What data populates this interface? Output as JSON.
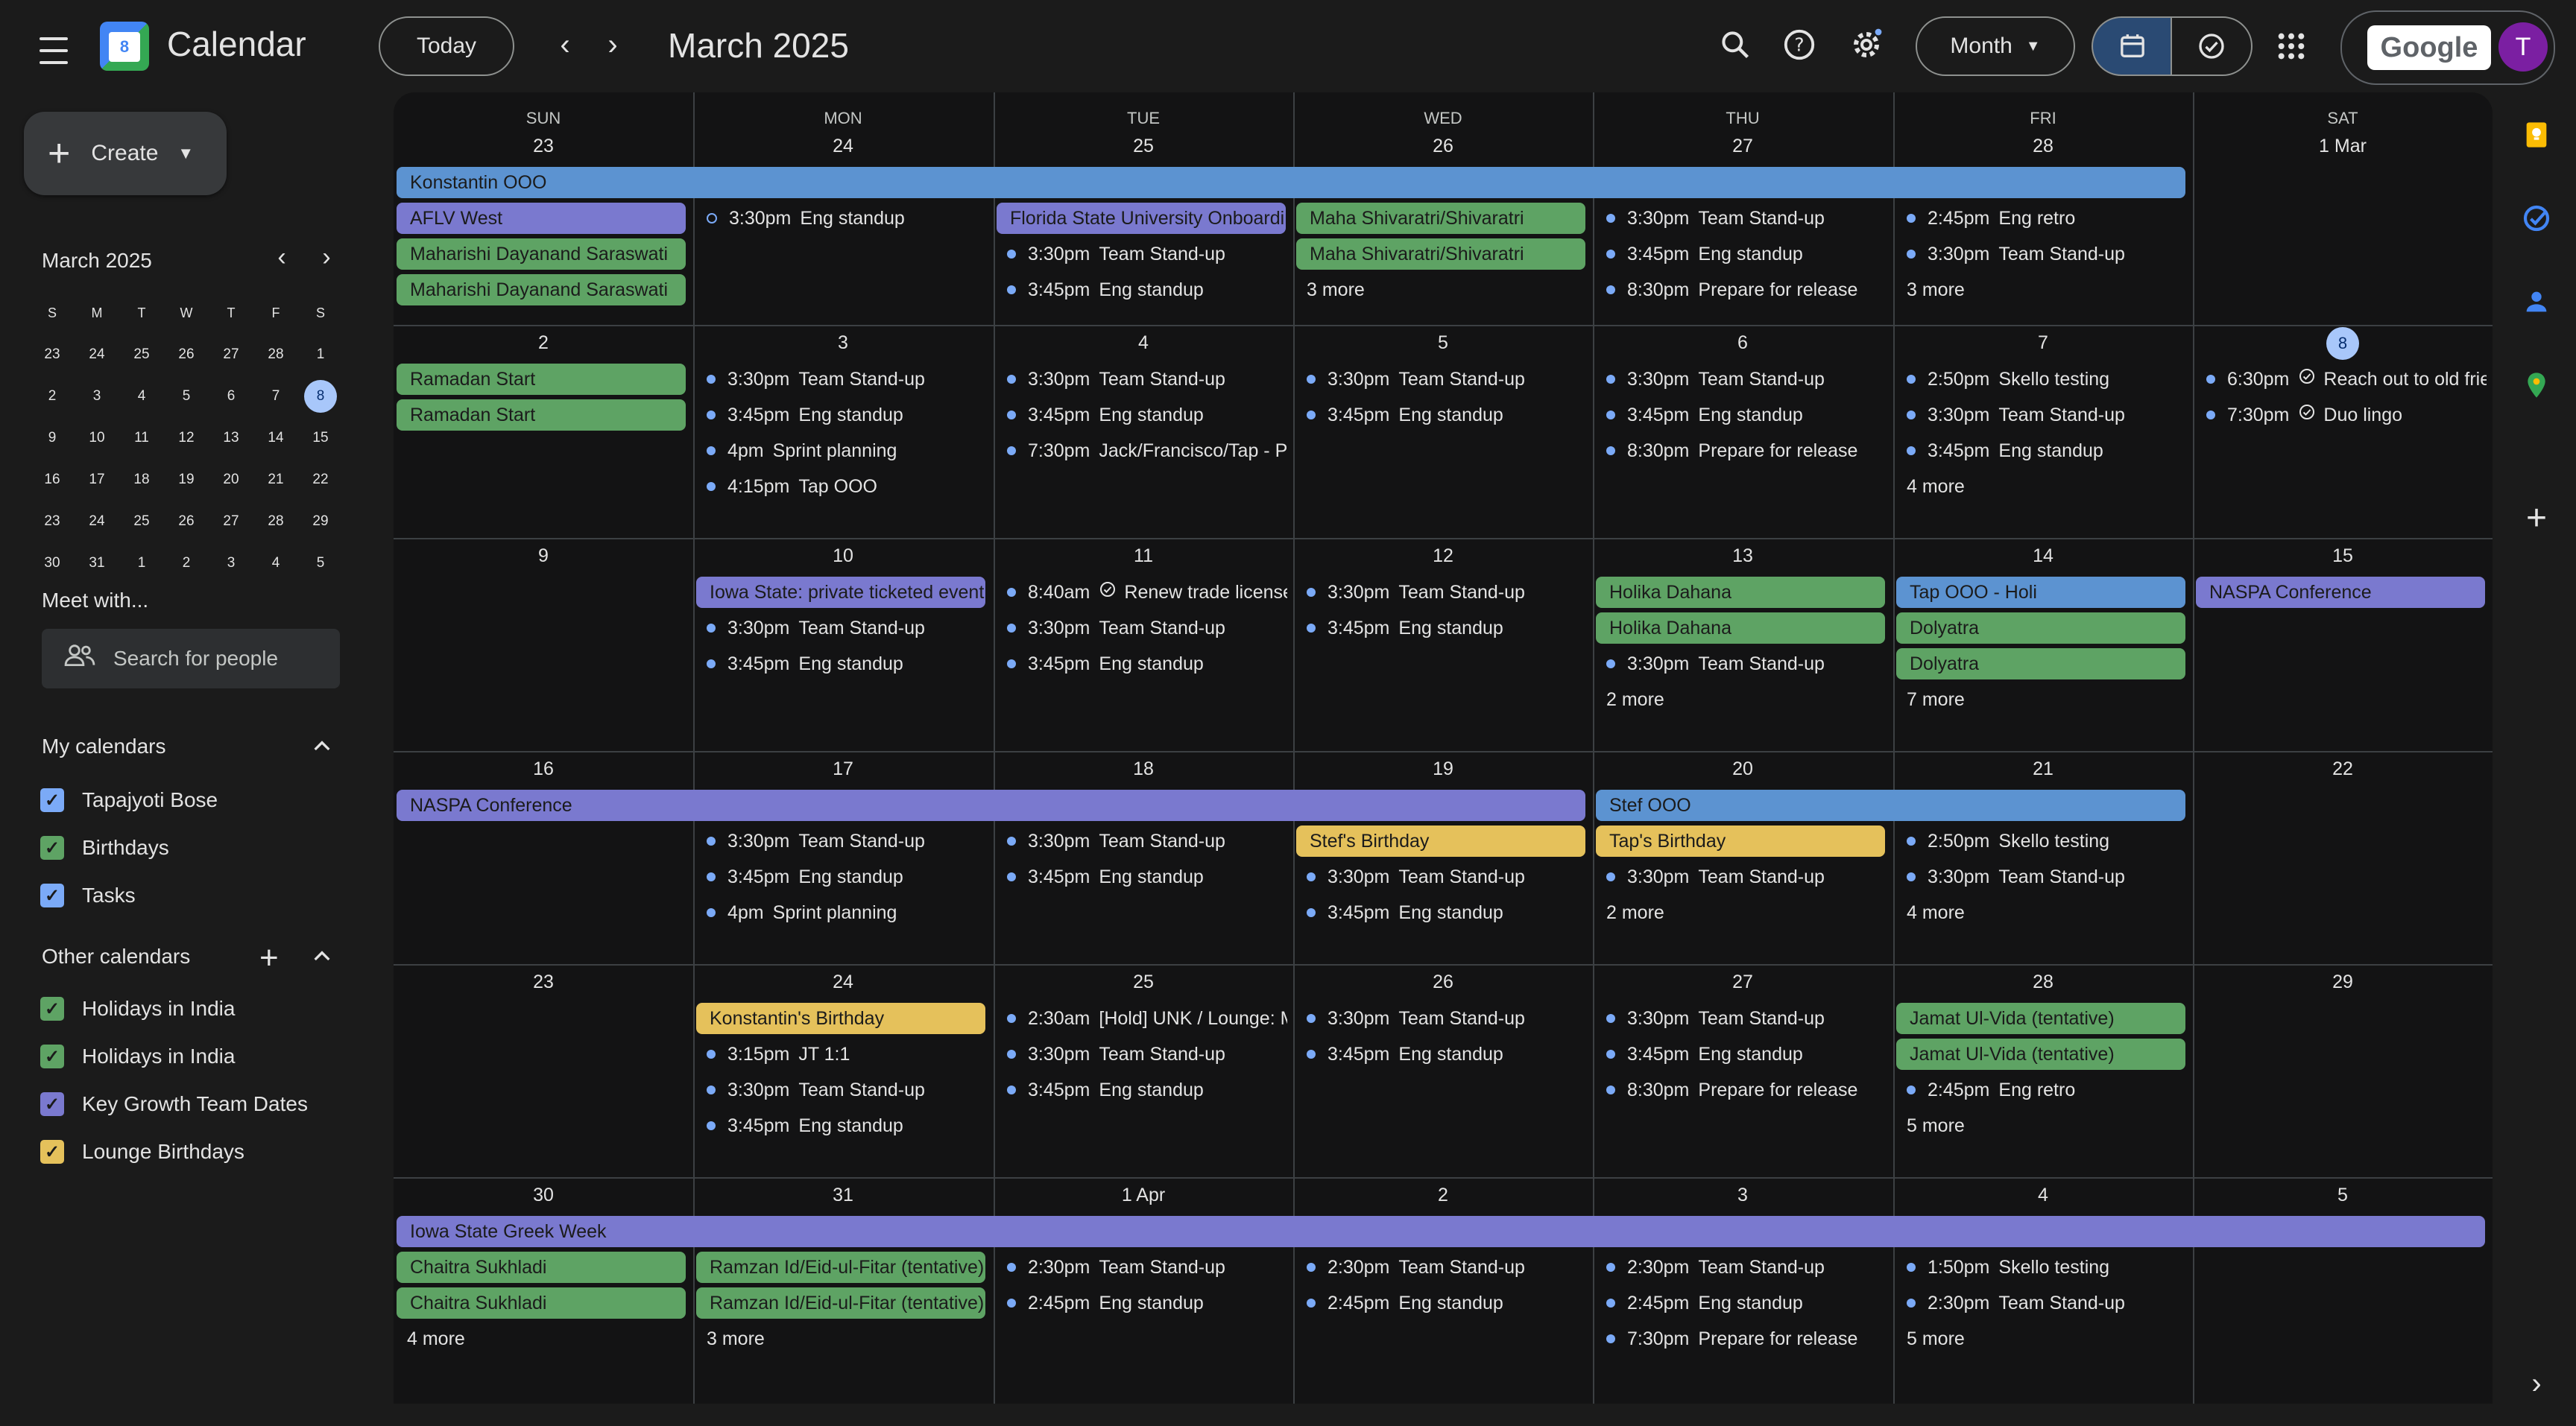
{
  "header": {
    "app_title": "Calendar",
    "logo_day": "8",
    "today_label": "Today",
    "prev_label": "‹",
    "next_label": "›",
    "month_title": "March 2025",
    "view_label": "Month",
    "google_label": "Google",
    "avatar_letter": "T"
  },
  "sidebar": {
    "create_label": "Create",
    "mini_title": "March 2025",
    "mini_prev": "‹",
    "mini_next": "›",
    "mini_weekdays": [
      "S",
      "M",
      "T",
      "W",
      "T",
      "F",
      "S"
    ],
    "mini_weeks": [
      [
        "23",
        "24",
        "25",
        "26",
        "27",
        "28",
        "1"
      ],
      [
        "2",
        "3",
        "4",
        "5",
        "6",
        "7",
        "8"
      ],
      [
        "9",
        "10",
        "11",
        "12",
        "13",
        "14",
        "15"
      ],
      [
        "16",
        "17",
        "18",
        "19",
        "20",
        "21",
        "22"
      ],
      [
        "23",
        "24",
        "25",
        "26",
        "27",
        "28",
        "29"
      ],
      [
        "30",
        "31",
        "1",
        "2",
        "3",
        "4",
        "5"
      ]
    ],
    "mini_today": "8",
    "meet_label": "Meet with...",
    "people_placeholder": "Search for people",
    "my_calendars_label": "My calendars",
    "my_calendars": [
      {
        "name": "Tapajyoti Bose",
        "color": "#7baaf7"
      },
      {
        "name": "Birthdays",
        "color": "#5ea364"
      },
      {
        "name": "Tasks",
        "color": "#7baaf7"
      }
    ],
    "other_calendars_label": "Other calendars",
    "other_calendars": [
      {
        "name": "Holidays in India",
        "color": "#5ea364"
      },
      {
        "name": "Holidays in India",
        "color": "#5ea364"
      },
      {
        "name": "Key Growth Team Dates",
        "color": "#7a79cf"
      },
      {
        "name": "Lounge Birthdays",
        "color": "#e5c15b"
      }
    ]
  },
  "grid": {
    "weekdays": [
      "SUN",
      "MON",
      "TUE",
      "WED",
      "THU",
      "FRI",
      "SAT"
    ],
    "weeks": [
      {
        "days": [
          "23",
          "24",
          "25",
          "26",
          "27",
          "28",
          "1 Mar"
        ],
        "bars": [
          {
            "text": "Konstantin OOO",
            "start": 0,
            "span": 6,
            "row": 0,
            "color": "blue"
          },
          {
            "text": "AFLV West",
            "start": 0,
            "span": 1,
            "row": 1,
            "color": "purple"
          },
          {
            "text": "Maharishi Dayanand Saraswati",
            "start": 0,
            "span": 1,
            "row": 2,
            "color": "green"
          },
          {
            "text": "Maharishi Dayanand Saraswati",
            "start": 0,
            "span": 1,
            "row": 3,
            "color": "green"
          },
          {
            "text": "Florida State University Onboarding",
            "start": 2,
            "span": 1,
            "row": 1,
            "color": "purple"
          },
          {
            "text": "Maha Shivaratri/Shivaratri",
            "start": 3,
            "span": 1,
            "row": 1,
            "color": "green"
          },
          {
            "text": "Maha Shivaratri/Shivaratri",
            "start": 3,
            "span": 1,
            "row": 2,
            "color": "green"
          }
        ],
        "events": [
          {
            "day": 1,
            "row": 1,
            "time": "3:30pm",
            "title": "Eng standup",
            "hollow": true
          },
          {
            "day": 2,
            "row": 2,
            "time": "3:30pm",
            "title": "Team Stand-up"
          },
          {
            "day": 2,
            "row": 3,
            "time": "3:45pm",
            "title": "Eng standup"
          },
          {
            "day": 4,
            "row": 1,
            "time": "3:30pm",
            "title": "Team Stand-up"
          },
          {
            "day": 4,
            "row": 2,
            "time": "3:45pm",
            "title": "Eng standup"
          },
          {
            "day": 4,
            "row": 3,
            "time": "8:30pm",
            "title": "Prepare for release"
          },
          {
            "day": 5,
            "row": 1,
            "time": "2:45pm",
            "title": "Eng retro"
          },
          {
            "day": 5,
            "row": 2,
            "time": "3:30pm",
            "title": "Team Stand-up"
          }
        ],
        "more": [
          {
            "day": 3,
            "row": 3,
            "text": "3 more"
          },
          {
            "day": 5,
            "row": 3,
            "text": "3 more"
          }
        ]
      },
      {
        "days": [
          "2",
          "3",
          "4",
          "5",
          "6",
          "7",
          "8"
        ],
        "bars": [
          {
            "text": "Ramadan Start",
            "start": 0,
            "span": 1,
            "row": 0,
            "color": "green"
          },
          {
            "text": "Ramadan Start",
            "start": 0,
            "span": 1,
            "row": 1,
            "color": "green"
          }
        ],
        "events": [
          {
            "day": 1,
            "row": 0,
            "time": "3:30pm",
            "title": "Team Stand-up"
          },
          {
            "day": 1,
            "row": 1,
            "time": "3:45pm",
            "title": "Eng standup"
          },
          {
            "day": 1,
            "row": 2,
            "time": "4pm",
            "title": "Sprint planning"
          },
          {
            "day": 1,
            "row": 3,
            "time": "4:15pm",
            "title": "Tap OOO"
          },
          {
            "day": 2,
            "row": 0,
            "time": "3:30pm",
            "title": "Team Stand-up"
          },
          {
            "day": 2,
            "row": 1,
            "time": "3:45pm",
            "title": "Eng standup"
          },
          {
            "day": 2,
            "row": 2,
            "time": "7:30pm",
            "title": "Jack/Francisco/Tap - Planning"
          },
          {
            "day": 3,
            "row": 0,
            "time": "3:30pm",
            "title": "Team Stand-up"
          },
          {
            "day": 3,
            "row": 1,
            "time": "3:45pm",
            "title": "Eng standup"
          },
          {
            "day": 4,
            "row": 0,
            "time": "3:30pm",
            "title": "Team Stand-up"
          },
          {
            "day": 4,
            "row": 1,
            "time": "3:45pm",
            "title": "Eng standup"
          },
          {
            "day": 4,
            "row": 2,
            "time": "8:30pm",
            "title": "Prepare for release"
          },
          {
            "day": 5,
            "row": 0,
            "time": "2:50pm",
            "title": "Skello testing"
          },
          {
            "day": 5,
            "row": 1,
            "time": "3:30pm",
            "title": "Team Stand-up"
          },
          {
            "day": 5,
            "row": 2,
            "time": "3:45pm",
            "title": "Eng standup"
          },
          {
            "day": 6,
            "row": 0,
            "time": "6:30pm",
            "title": "Reach out to old friends",
            "task": true
          },
          {
            "day": 6,
            "row": 1,
            "time": "7:30pm",
            "title": "Duo lingo",
            "task": true
          }
        ],
        "more": [
          {
            "day": 5,
            "row": 3,
            "text": "4 more"
          }
        ]
      },
      {
        "days": [
          "9",
          "10",
          "11",
          "12",
          "13",
          "14",
          "15"
        ],
        "bars": [
          {
            "text": "Iowa State: private ticketed event",
            "start": 1,
            "span": 1,
            "row": 0,
            "color": "purple"
          },
          {
            "text": "Holika Dahana",
            "start": 4,
            "span": 1,
            "row": 0,
            "color": "green"
          },
          {
            "text": "Holika Dahana",
            "start": 4,
            "span": 1,
            "row": 1,
            "color": "green"
          },
          {
            "text": "Tap OOO - Holi",
            "start": 5,
            "span": 1,
            "row": 0,
            "color": "blue"
          },
          {
            "text": "Dolyatra",
            "start": 5,
            "span": 1,
            "row": 1,
            "color": "green"
          },
          {
            "text": "Dolyatra",
            "start": 5,
            "span": 1,
            "row": 2,
            "color": "green"
          },
          {
            "text": "NASPA Conference",
            "start": 6,
            "span": 1,
            "row": 0,
            "color": "purple"
          }
        ],
        "events": [
          {
            "day": 1,
            "row": 1,
            "time": "3:30pm",
            "title": "Team Stand-up"
          },
          {
            "day": 1,
            "row": 2,
            "time": "3:45pm",
            "title": "Eng standup"
          },
          {
            "day": 2,
            "row": 0,
            "time": "8:40am",
            "title": "Renew trade license",
            "task": true
          },
          {
            "day": 2,
            "row": 1,
            "time": "3:30pm",
            "title": "Team Stand-up"
          },
          {
            "day": 2,
            "row": 2,
            "time": "3:45pm",
            "title": "Eng standup"
          },
          {
            "day": 3,
            "row": 0,
            "time": "3:30pm",
            "title": "Team Stand-up"
          },
          {
            "day": 3,
            "row": 1,
            "time": "3:45pm",
            "title": "Eng standup"
          },
          {
            "day": 4,
            "row": 2,
            "time": "3:30pm",
            "title": "Team Stand-up"
          }
        ],
        "more": [
          {
            "day": 4,
            "row": 3,
            "text": "2 more"
          },
          {
            "day": 5,
            "row": 3,
            "text": "7 more"
          }
        ]
      },
      {
        "days": [
          "16",
          "17",
          "18",
          "19",
          "20",
          "21",
          "22"
        ],
        "bars": [
          {
            "text": "NASPA Conference",
            "start": 0,
            "span": 4,
            "row": 0,
            "color": "purple"
          },
          {
            "text": "Stef OOO",
            "start": 4,
            "span": 2,
            "row": 0,
            "color": "blue"
          },
          {
            "text": "Stef's Birthday",
            "start": 3,
            "span": 1,
            "row": 1,
            "color": "yellow"
          },
          {
            "text": "Tap's Birthday",
            "start": 4,
            "span": 1,
            "row": 1,
            "color": "yellow"
          }
        ],
        "events": [
          {
            "day": 1,
            "row": 1,
            "time": "3:30pm",
            "title": "Team Stand-up"
          },
          {
            "day": 1,
            "row": 2,
            "time": "3:45pm",
            "title": "Eng standup"
          },
          {
            "day": 1,
            "row": 3,
            "time": "4pm",
            "title": "Sprint planning"
          },
          {
            "day": 2,
            "row": 1,
            "time": "3:30pm",
            "title": "Team Stand-up"
          },
          {
            "day": 2,
            "row": 2,
            "time": "3:45pm",
            "title": "Eng standup"
          },
          {
            "day": 3,
            "row": 2,
            "time": "3:30pm",
            "title": "Team Stand-up"
          },
          {
            "day": 3,
            "row": 3,
            "time": "3:45pm",
            "title": "Eng standup"
          },
          {
            "day": 4,
            "row": 2,
            "time": "3:30pm",
            "title": "Team Stand-up"
          },
          {
            "day": 5,
            "row": 1,
            "time": "2:50pm",
            "title": "Skello testing"
          },
          {
            "day": 5,
            "row": 2,
            "time": "3:30pm",
            "title": "Team Stand-up"
          }
        ],
        "more": [
          {
            "day": 4,
            "row": 3,
            "text": "2 more"
          },
          {
            "day": 5,
            "row": 3,
            "text": "4 more"
          }
        ]
      },
      {
        "days": [
          "23",
          "24",
          "25",
          "26",
          "27",
          "28",
          "29"
        ],
        "bars": [
          {
            "text": "Konstantin's Birthday",
            "start": 1,
            "span": 1,
            "row": 0,
            "color": "yellow"
          },
          {
            "text": "Jamat Ul-Vida (tentative)",
            "start": 5,
            "span": 1,
            "row": 0,
            "color": "green"
          },
          {
            "text": "Jamat Ul-Vida (tentative)",
            "start": 5,
            "span": 1,
            "row": 1,
            "color": "green"
          }
        ],
        "events": [
          {
            "day": 1,
            "row": 1,
            "time": "3:15pm",
            "title": "JT 1:1"
          },
          {
            "day": 1,
            "row": 2,
            "time": "3:30pm",
            "title": "Team Stand-up"
          },
          {
            "day": 1,
            "row": 3,
            "time": "3:45pm",
            "title": "Eng standup"
          },
          {
            "day": 2,
            "row": 0,
            "time": "2:30am",
            "title": "[Hold] UNK / Lounge: Meeting"
          },
          {
            "day": 2,
            "row": 1,
            "time": "3:30pm",
            "title": "Team Stand-up"
          },
          {
            "day": 2,
            "row": 2,
            "time": "3:45pm",
            "title": "Eng standup"
          },
          {
            "day": 3,
            "row": 0,
            "time": "3:30pm",
            "title": "Team Stand-up"
          },
          {
            "day": 3,
            "row": 1,
            "time": "3:45pm",
            "title": "Eng standup"
          },
          {
            "day": 4,
            "row": 0,
            "time": "3:30pm",
            "title": "Team Stand-up"
          },
          {
            "day": 4,
            "row": 1,
            "time": "3:45pm",
            "title": "Eng standup"
          },
          {
            "day": 4,
            "row": 2,
            "time": "8:30pm",
            "title": "Prepare for release"
          },
          {
            "day": 5,
            "row": 2,
            "time": "2:45pm",
            "title": "Eng retro"
          }
        ],
        "more": [
          {
            "day": 5,
            "row": 3,
            "text": "5 more"
          }
        ]
      },
      {
        "days": [
          "30",
          "31",
          "1 Apr",
          "2",
          "3",
          "4",
          "5"
        ],
        "bars": [
          {
            "text": "Iowa State Greek Week",
            "start": 0,
            "span": 7,
            "row": 0,
            "color": "purple"
          },
          {
            "text": "Chaitra Sukhladi",
            "start": 0,
            "span": 1,
            "row": 1,
            "color": "green"
          },
          {
            "text": "Chaitra Sukhladi",
            "start": 0,
            "span": 1,
            "row": 2,
            "color": "green"
          },
          {
            "text": "Ramzan Id/Eid-ul-Fitar (tentative)",
            "start": 1,
            "span": 1,
            "row": 1,
            "color": "green"
          },
          {
            "text": "Ramzan Id/Eid-ul-Fitar (tentative)",
            "start": 1,
            "span": 1,
            "row": 2,
            "color": "green"
          }
        ],
        "events": [
          {
            "day": 2,
            "row": 1,
            "time": "2:30pm",
            "title": "Team Stand-up"
          },
          {
            "day": 2,
            "row": 2,
            "time": "2:45pm",
            "title": "Eng standup"
          },
          {
            "day": 3,
            "row": 1,
            "time": "2:30pm",
            "title": "Team Stand-up"
          },
          {
            "day": 3,
            "row": 2,
            "time": "2:45pm",
            "title": "Eng standup"
          },
          {
            "day": 4,
            "row": 1,
            "time": "2:30pm",
            "title": "Team Stand-up"
          },
          {
            "day": 4,
            "row": 2,
            "time": "2:45pm",
            "title": "Eng standup"
          },
          {
            "day": 4,
            "row": 3,
            "time": "7:30pm",
            "title": "Prepare for release"
          },
          {
            "day": 5,
            "row": 1,
            "time": "1:50pm",
            "title": "Skello testing"
          },
          {
            "day": 5,
            "row": 2,
            "time": "2:30pm",
            "title": "Team Stand-up"
          }
        ],
        "more": [
          {
            "day": 0,
            "row": 3,
            "text": "4 more"
          },
          {
            "day": 1,
            "row": 3,
            "text": "3 more"
          },
          {
            "day": 5,
            "row": 3,
            "text": "5 more"
          }
        ]
      }
    ]
  },
  "today_marker": {
    "week": 1,
    "day": 6
  }
}
